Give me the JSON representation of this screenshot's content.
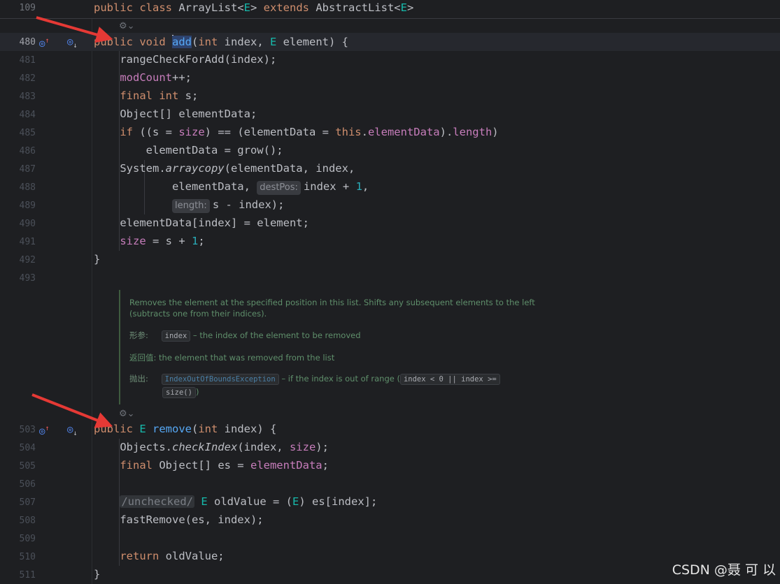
{
  "sticky": {
    "line_number": "109",
    "segments": [
      {
        "t": "public class ",
        "c": "kw"
      },
      {
        "t": "ArrayList<",
        "c": ""
      },
      {
        "t": "E",
        "c": "tp"
      },
      {
        "t": "> ",
        "c": ""
      },
      {
        "t": "extends ",
        "c": "kw"
      },
      {
        "t": "AbstractList<",
        "c": ""
      },
      {
        "t": "E",
        "c": "tp"
      },
      {
        "t": ">",
        "c": ""
      }
    ]
  },
  "lines": [
    {
      "n": "480",
      "current": true,
      "segments": [
        {
          "t": "public void ",
          "c": "kw"
        },
        {
          "t": "",
          "c": "caret"
        },
        {
          "t": "add",
          "c": "fn hl"
        },
        {
          "t": "(",
          "c": ""
        },
        {
          "t": "int ",
          "c": "kw"
        },
        {
          "t": "index, ",
          "c": ""
        },
        {
          "t": "E ",
          "c": "tp"
        },
        {
          "t": "element) {",
          "c": ""
        }
      ]
    },
    {
      "n": "481",
      "segments": [
        {
          "t": "    rangeCheckForAdd(index);",
          "c": ""
        }
      ]
    },
    {
      "n": "482",
      "segments": [
        {
          "t": "    ",
          "c": ""
        },
        {
          "t": "modCount",
          "c": "fld"
        },
        {
          "t": "++;",
          "c": ""
        }
      ]
    },
    {
      "n": "483",
      "segments": [
        {
          "t": "    ",
          "c": ""
        },
        {
          "t": "final int ",
          "c": "kw"
        },
        {
          "t": "s;",
          "c": ""
        }
      ]
    },
    {
      "n": "484",
      "segments": [
        {
          "t": "    Object[] elementData;",
          "c": ""
        }
      ]
    },
    {
      "n": "485",
      "segments": [
        {
          "t": "    ",
          "c": ""
        },
        {
          "t": "if ",
          "c": "kw"
        },
        {
          "t": "((s = ",
          "c": ""
        },
        {
          "t": "size",
          "c": "fld"
        },
        {
          "t": ") == (elementData = ",
          "c": ""
        },
        {
          "t": "this",
          "c": "kw"
        },
        {
          "t": ".",
          "c": ""
        },
        {
          "t": "elementData",
          "c": "fld"
        },
        {
          "t": ").",
          "c": ""
        },
        {
          "t": "length",
          "c": "fld"
        },
        {
          "t": ")",
          "c": ""
        }
      ]
    },
    {
      "n": "486",
      "segments": [
        {
          "t": "        elementData = grow();",
          "c": ""
        }
      ]
    },
    {
      "n": "487",
      "segments": [
        {
          "t": "    System.",
          "c": ""
        },
        {
          "t": "arraycopy",
          "c": "it"
        },
        {
          "t": "(elementData, index,",
          "c": ""
        }
      ]
    },
    {
      "n": "488",
      "segments": [
        {
          "t": "            elementData, ",
          "c": ""
        },
        {
          "t": "destPos:",
          "c": "hint"
        },
        {
          "t": "index + ",
          "c": ""
        },
        {
          "t": "1",
          "c": "num"
        },
        {
          "t": ",",
          "c": ""
        }
      ]
    },
    {
      "n": "489",
      "segments": [
        {
          "t": "            ",
          "c": ""
        },
        {
          "t": "length:",
          "c": "hint"
        },
        {
          "t": "s - index);",
          "c": ""
        }
      ]
    },
    {
      "n": "490",
      "segments": [
        {
          "t": "    elementData[index] = element;",
          "c": ""
        }
      ]
    },
    {
      "n": "491",
      "segments": [
        {
          "t": "    ",
          "c": ""
        },
        {
          "t": "size",
          "c": "fld"
        },
        {
          "t": " = s + ",
          "c": ""
        },
        {
          "t": "1",
          "c": "num"
        },
        {
          "t": ";",
          "c": ""
        }
      ]
    },
    {
      "n": "492",
      "segments": [
        {
          "t": "}",
          "c": ""
        }
      ]
    },
    {
      "n": "493",
      "segments": []
    },
    {
      "n": "503",
      "segments": [
        {
          "t": "public ",
          "c": "kw"
        },
        {
          "t": "E ",
          "c": "tp"
        },
        {
          "t": "remove",
          "c": "fn"
        },
        {
          "t": "(",
          "c": ""
        },
        {
          "t": "int ",
          "c": "kw"
        },
        {
          "t": "index) {",
          "c": ""
        }
      ]
    },
    {
      "n": "504",
      "segments": [
        {
          "t": "    Objects.",
          "c": ""
        },
        {
          "t": "checkIndex",
          "c": "it"
        },
        {
          "t": "(index, ",
          "c": ""
        },
        {
          "t": "size",
          "c": "fld"
        },
        {
          "t": ");",
          "c": ""
        }
      ]
    },
    {
      "n": "505",
      "segments": [
        {
          "t": "    ",
          "c": ""
        },
        {
          "t": "final ",
          "c": "kw"
        },
        {
          "t": "Object[] es = ",
          "c": ""
        },
        {
          "t": "elementData",
          "c": "fld"
        },
        {
          "t": ";",
          "c": ""
        }
      ]
    },
    {
      "n": "506",
      "segments": []
    },
    {
      "n": "507",
      "segments": [
        {
          "t": "    ",
          "c": ""
        },
        {
          "t": "/unchecked/",
          "c": "unchecked"
        },
        {
          "t": " ",
          "c": ""
        },
        {
          "t": "E ",
          "c": "tp"
        },
        {
          "t": "oldValue = (",
          "c": ""
        },
        {
          "t": "E",
          "c": "tp"
        },
        {
          "t": ") es[index];",
          "c": ""
        }
      ]
    },
    {
      "n": "508",
      "segments": [
        {
          "t": "    fastRemove(es, index);",
          "c": ""
        }
      ]
    },
    {
      "n": "509",
      "segments": []
    },
    {
      "n": "510",
      "segments": [
        {
          "t": "    ",
          "c": ""
        },
        {
          "t": "return ",
          "c": "kw"
        },
        {
          "t": "oldValue;",
          "c": ""
        }
      ]
    },
    {
      "n": "511",
      "segments": [
        {
          "t": "}",
          "c": ""
        }
      ]
    }
  ],
  "gutter_icons": {
    "overrides": "overrides-icon",
    "overridden": "overridden-icon"
  },
  "doc": {
    "description": "Removes the element at the specified position in this list. Shifts any subsequent elements to the left (subtracts one from their indices).",
    "param_label": "形参:",
    "param_name": "index",
    "param_text": " – the index of the element to be removed",
    "return_label": "返回值:",
    "return_text": " the element that was removed from the list",
    "throws_label": "抛出:",
    "throws_exception": "IndexOutOfBoundsException",
    "throws_text": " – if the index is out of range (",
    "throws_code1": "index < 0 || index >=",
    "throws_code2": "size()",
    "throws_close": ")"
  },
  "watermark": "CSDN @聂 可 以",
  "colors": {
    "arrow": "#e53935",
    "background": "#1e1f22"
  }
}
